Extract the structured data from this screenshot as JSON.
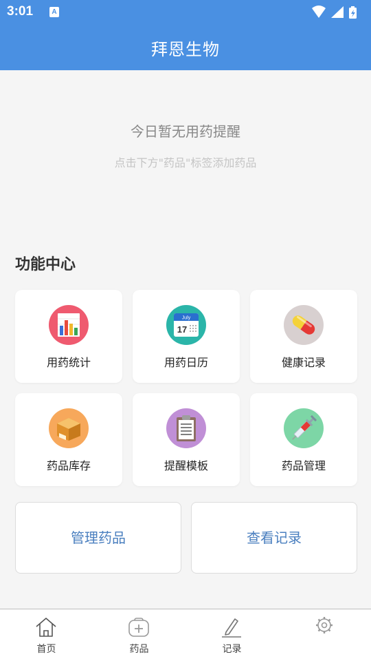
{
  "status_bar": {
    "time": "3:01",
    "notification_icon_text": "A"
  },
  "header": {
    "title": "拜恩生物"
  },
  "empty_state": {
    "title": "今日暂无用药提醒",
    "subtitle": "点击下方\"药品\"标签添加药品"
  },
  "function_center": {
    "title": "功能中心",
    "items": [
      {
        "label": "用药统计",
        "icon": "bar-chart-icon",
        "bg": "#ef5a6f"
      },
      {
        "label": "用药日历",
        "icon": "calendar-icon",
        "bg": "#2bb5a9",
        "icon_text_month": "July",
        "icon_text_day": "17"
      },
      {
        "label": "健康记录",
        "icon": "pill-icon",
        "bg": "#d8d0d0"
      },
      {
        "label": "药品库存",
        "icon": "box-icon",
        "bg": "#f7a85b"
      },
      {
        "label": "提醒模板",
        "icon": "clipboard-icon",
        "bg": "#c08fd6"
      },
      {
        "label": "药品管理",
        "icon": "syringe-icon",
        "bg": "#7dd6a6"
      }
    ]
  },
  "buttons": {
    "manage_drugs": "管理药品",
    "view_records": "查看记录"
  },
  "bottom_nav": [
    {
      "label": "首页",
      "icon": "home-icon"
    },
    {
      "label": "药品",
      "icon": "medicine-box-icon"
    },
    {
      "label": "记录",
      "icon": "pencil-icon"
    },
    {
      "label": "",
      "icon": "settings-gear-icon"
    }
  ],
  "colors": {
    "primary": "#4a90e2",
    "background": "#f5f5f5",
    "button_text": "#4a7fbf"
  }
}
